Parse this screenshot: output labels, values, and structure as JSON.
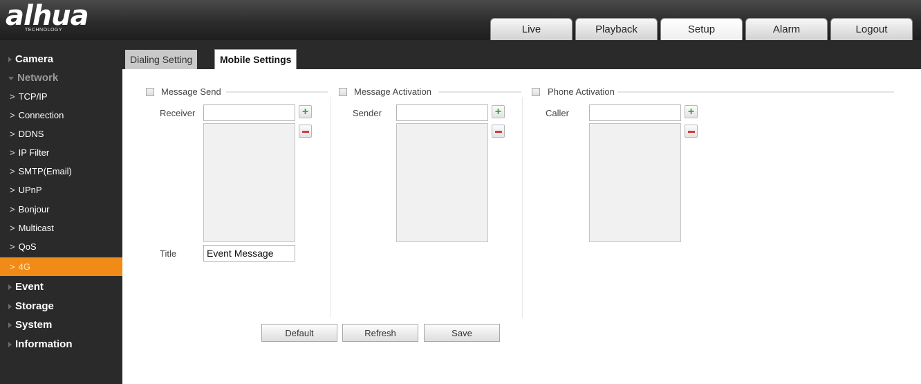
{
  "header": {
    "logo_text": "alhua",
    "logo_subtext": "TECHNOLOGY",
    "nav_tabs": [
      {
        "label": "Live"
      },
      {
        "label": "Playback"
      },
      {
        "label": "Setup",
        "active": true
      },
      {
        "label": "Alarm"
      },
      {
        "label": "Logout"
      }
    ]
  },
  "sidebar": {
    "camera": "Camera",
    "network": "Network",
    "network_items": [
      {
        "label": "TCP/IP"
      },
      {
        "label": "Connection"
      },
      {
        "label": "DDNS"
      },
      {
        "label": "IP Filter"
      },
      {
        "label": "SMTP(Email)"
      },
      {
        "label": "UPnP"
      },
      {
        "label": "Bonjour"
      },
      {
        "label": "Multicast"
      },
      {
        "label": "QoS"
      },
      {
        "label": "4G",
        "active": true
      }
    ],
    "event": "Event",
    "storage": "Storage",
    "system": "System",
    "information": "Information"
  },
  "subtabs": {
    "dialing": "Dialing Setting",
    "mobile": "Mobile Settings",
    "active": "Mobile Settings"
  },
  "message_send": {
    "section_label": "Message Send",
    "checked": false,
    "receiver_label": "Receiver",
    "receiver_value": "",
    "title_label": "Title",
    "title_value": "Event Message"
  },
  "message_activation": {
    "section_label": "Message Activation",
    "checked": false,
    "sender_label": "Sender",
    "sender_value": ""
  },
  "phone_activation": {
    "section_label": "Phone Activation",
    "checked": false,
    "caller_label": "Caller",
    "caller_value": ""
  },
  "buttons": {
    "default": "Default",
    "refresh": "Refresh",
    "save": "Save"
  },
  "colors": {
    "accent": "#f08b17",
    "sidebar_bg": "#2a2a2a",
    "add_icon": "#33a33a",
    "remove_icon": "#d23c3c"
  },
  "icons": {
    "add": "plus-icon",
    "remove": "minus-icon",
    "collapsed": "triangle-right-icon",
    "expanded": "triangle-down-icon",
    "item": "chevron-right-icon"
  }
}
